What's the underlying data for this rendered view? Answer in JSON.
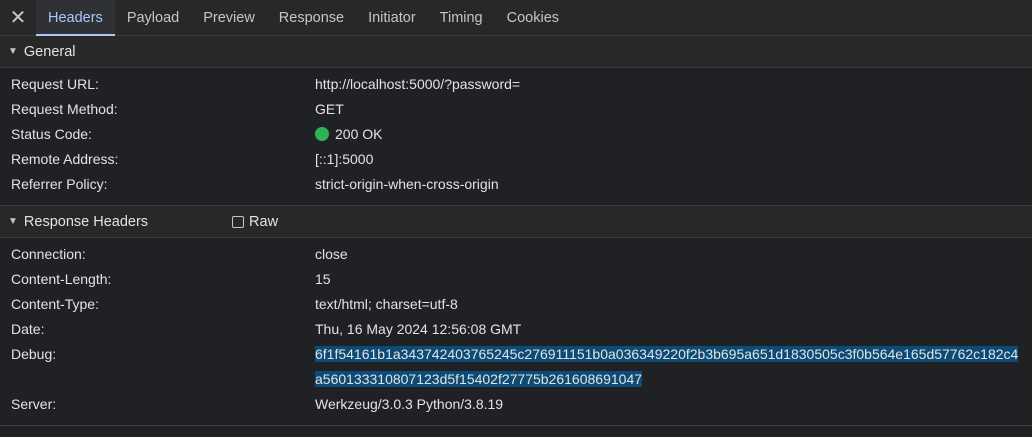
{
  "tabs": [
    "Headers",
    "Payload",
    "Preview",
    "Response",
    "Initiator",
    "Timing",
    "Cookies"
  ],
  "general": {
    "title": "General",
    "rows": [
      {
        "key": "Request URL:",
        "value": "http://localhost:5000/?password="
      },
      {
        "key": "Request Method:",
        "value": "GET"
      },
      {
        "key": "Status Code:",
        "value": "200 OK"
      },
      {
        "key": "Remote Address:",
        "value": "[::1]:5000"
      },
      {
        "key": "Referrer Policy:",
        "value": "strict-origin-when-cross-origin"
      }
    ]
  },
  "response_headers": {
    "title": "Response Headers",
    "raw_label": "Raw",
    "rows": [
      {
        "key": "Connection:",
        "value": "close"
      },
      {
        "key": "Content-Length:",
        "value": "15"
      },
      {
        "key": "Content-Type:",
        "value": "text/html; charset=utf-8"
      },
      {
        "key": "Date:",
        "value": "Thu, 16 May 2024 12:56:08 GMT"
      },
      {
        "key": "Debug:",
        "value": "6f1f54161b1a343742403765245c276911151b0a036349220f2b3b695a651d1830505c3f0b564e165d57762c182c4a560133310807123d5f15402f27775b261608691047"
      },
      {
        "key": "Server:",
        "value": "Werkzeug/3.0.3 Python/3.8.19"
      }
    ]
  },
  "colors": {
    "status_ok": "#2fb253",
    "active_tab": "#a8c7fa",
    "selection": "#0b4b75"
  },
  "icons": {
    "close": "close-icon",
    "expand": "triangle-down-icon"
  }
}
